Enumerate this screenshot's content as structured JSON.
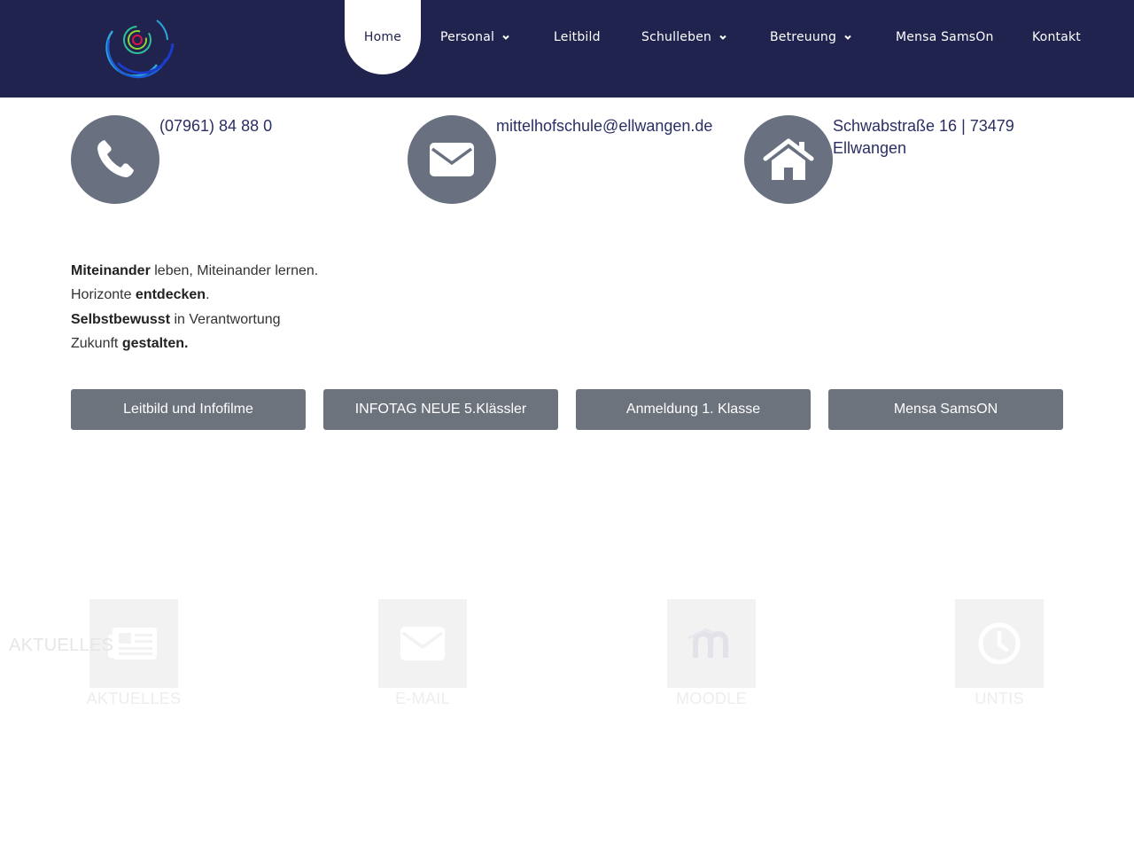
{
  "colors": {
    "header_bg": "#20234e",
    "icon_circle": "#697080",
    "button_bg": "#6c737d",
    "quicklink_bg": "#f2f2f2"
  },
  "nav": {
    "items": [
      {
        "label": "Home",
        "active": true
      },
      {
        "label": "Personal",
        "dropdown": true
      },
      {
        "label": "Leitbild"
      },
      {
        "label": "Schulleben",
        "dropdown": true
      },
      {
        "label": "Betreuung",
        "dropdown": true
      },
      {
        "label": "Mensa SamsOn"
      },
      {
        "label": "Kontakt"
      }
    ]
  },
  "contact": {
    "phone": {
      "icon": "phone-icon",
      "text": "(07961) 84 88 0"
    },
    "email": {
      "icon": "envelope-icon",
      "text": "mittelhofschule@ellwangen.de"
    },
    "address": {
      "icon": "home-icon",
      "line1": "Schwabstraße 16 | 73479",
      "line2": "Ellwangen"
    }
  },
  "motto": {
    "l1a": "Miteinander",
    "l1b": " leben,  Miteinander lernen.",
    "l2a": "Horizonte ",
    "l2b": "entdecken",
    "l2c": ".",
    "l3a": "Selbstbewusst",
    "l3b": " in Verantwortung",
    "l4a": "Zukunft ",
    "l4b": "gestalten."
  },
  "buttons": [
    {
      "label": "Leitbild und Infofilme"
    },
    {
      "label": "INFOTAG NEUE 5.Klässler"
    },
    {
      "label": "Anmeldung 1. Klasse"
    },
    {
      "label": "Mensa SamsON"
    }
  ],
  "quicklinks": {
    "ghost_label": "AKTUELLES",
    "items": [
      {
        "label": "AKTUELLES",
        "icon": "newspaper-icon"
      },
      {
        "label": "E-MAIL",
        "icon": "envelope-icon"
      },
      {
        "label": "MOODLE",
        "icon": "moodle-icon"
      },
      {
        "label": "UNTIS",
        "icon": "clock-icon"
      }
    ]
  }
}
